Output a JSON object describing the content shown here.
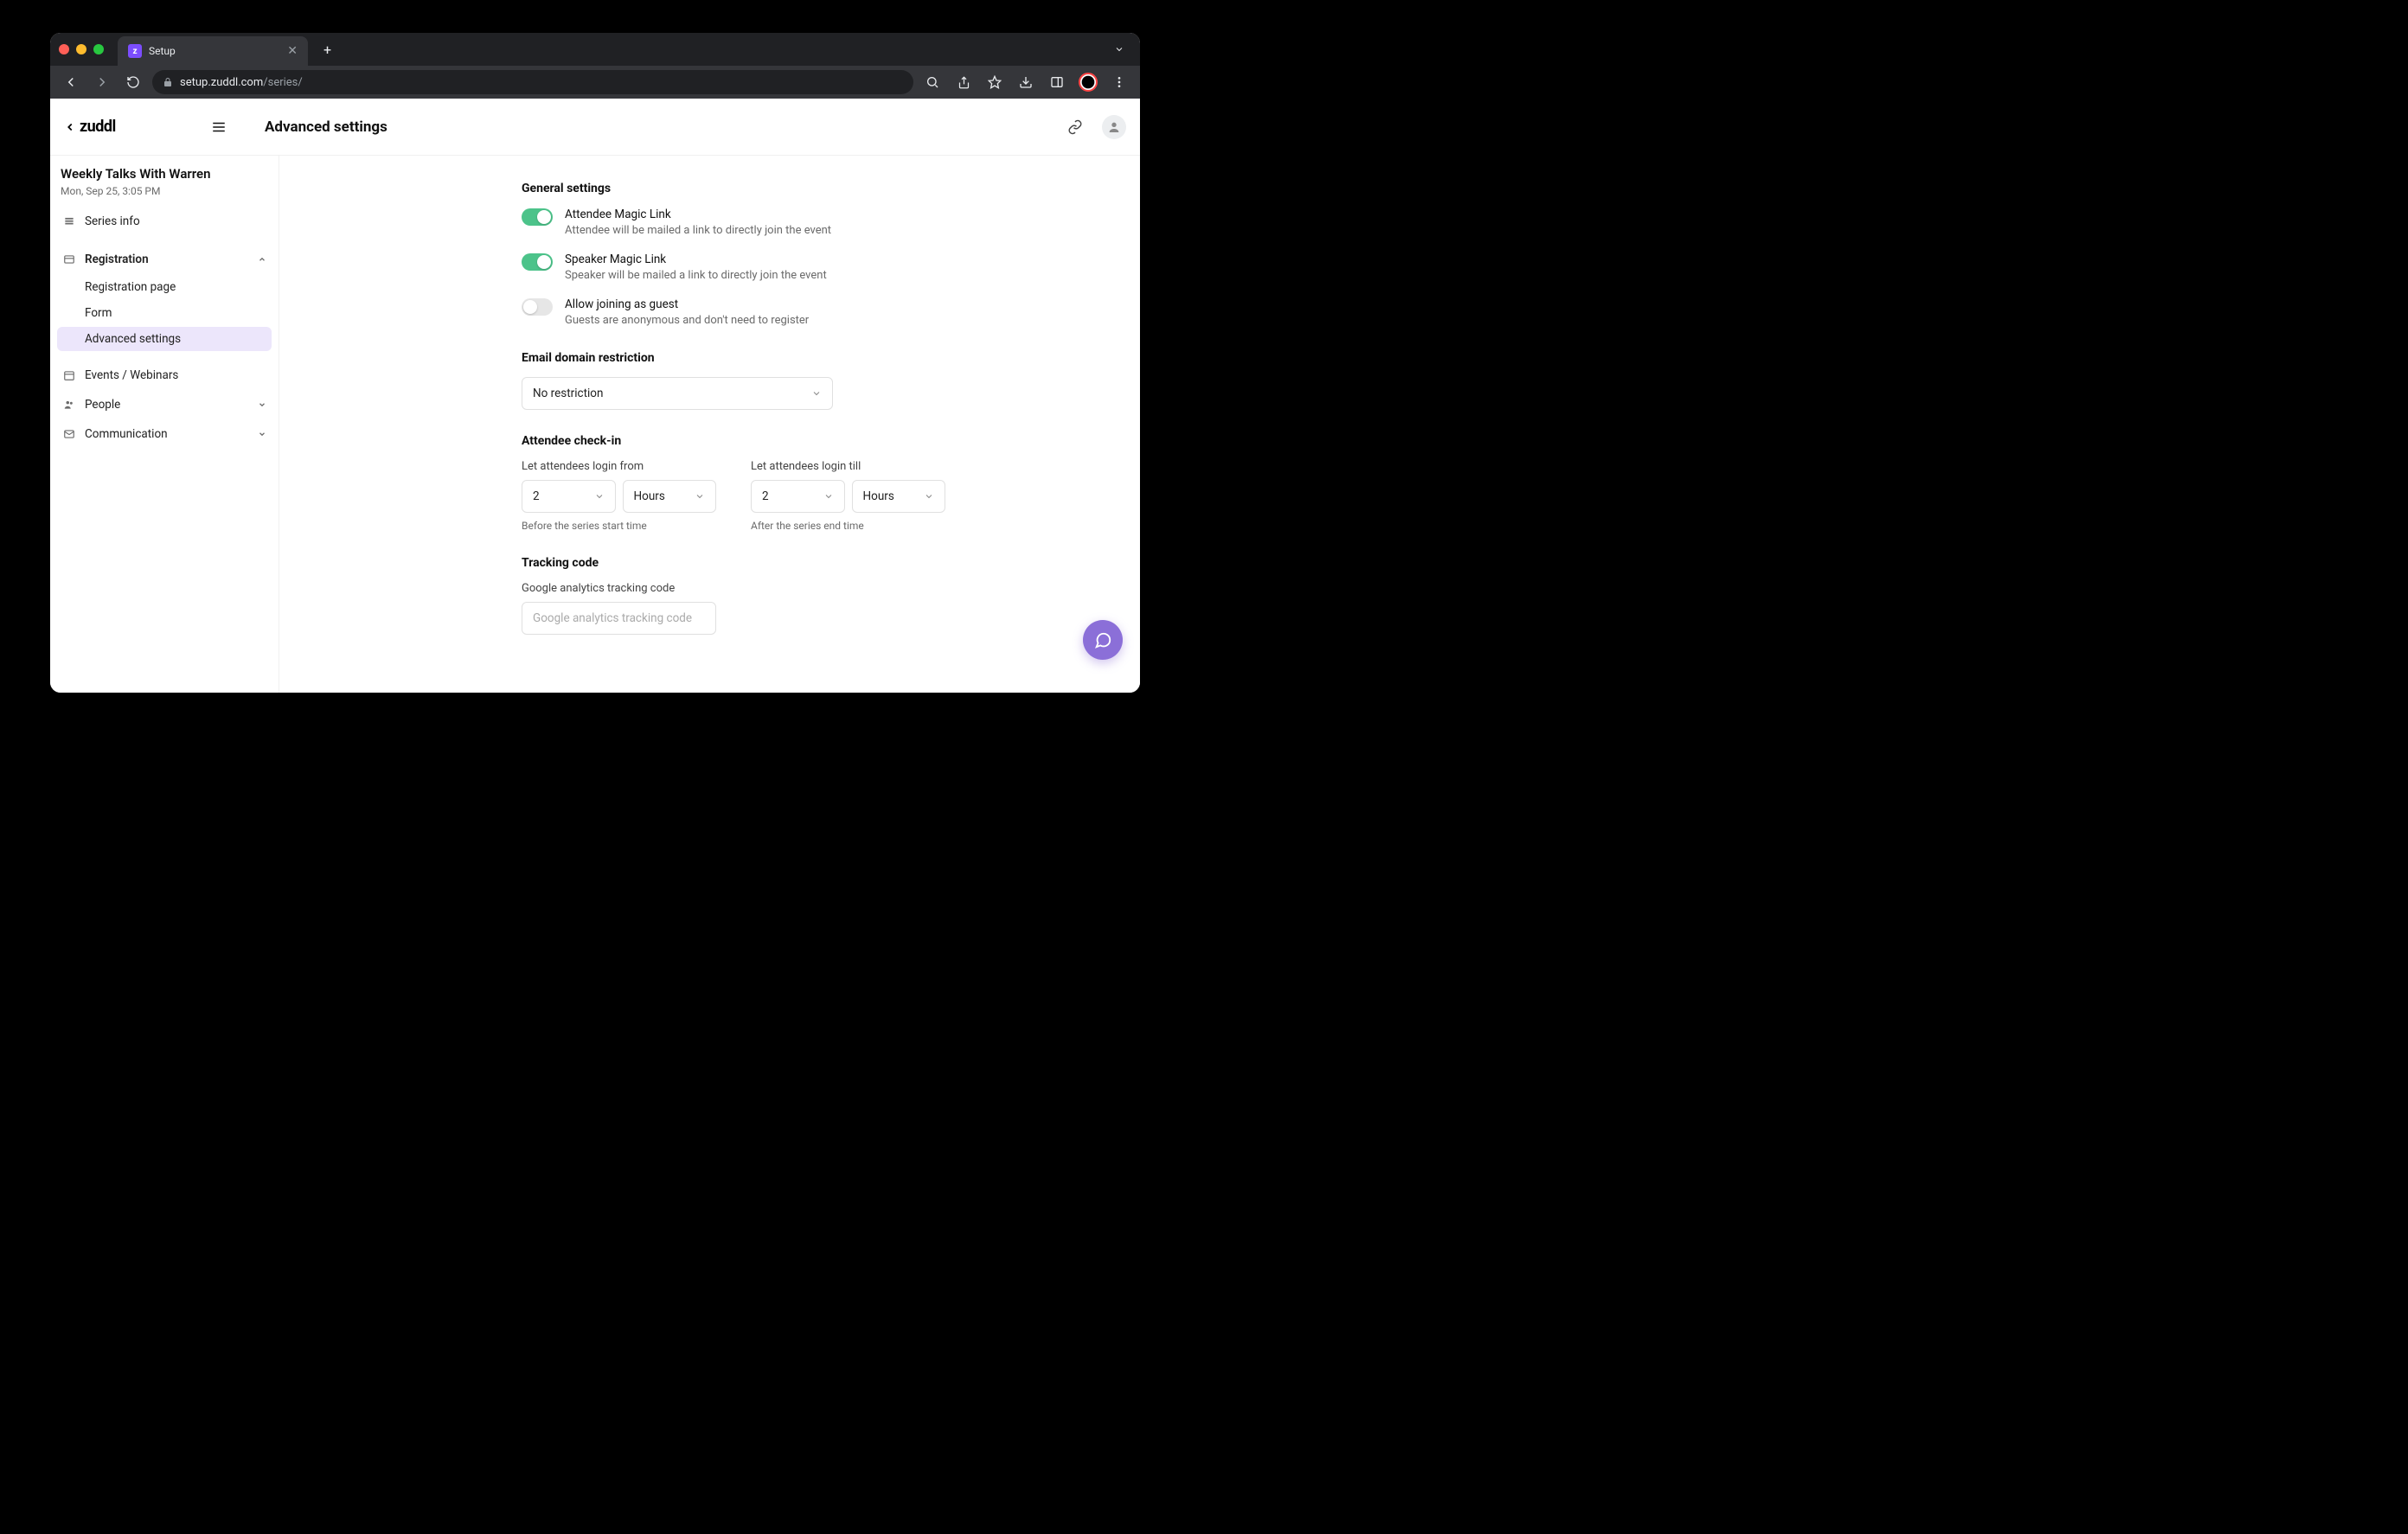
{
  "browser": {
    "tab_title": "Setup",
    "url_domain": "setup.zuddl.com",
    "url_path": "/series/"
  },
  "header": {
    "logo": "zuddl",
    "page_title": "Advanced settings"
  },
  "sidebar": {
    "event_title": "Weekly Talks With Warren",
    "event_date": "Mon, Sep 25, 3:05 PM",
    "items": [
      {
        "label": "Series info"
      },
      {
        "label": "Registration"
      },
      {
        "label": "Events / Webinars"
      },
      {
        "label": "People"
      },
      {
        "label": "Communication"
      }
    ],
    "sub_items": [
      {
        "label": "Registration page"
      },
      {
        "label": "Form"
      },
      {
        "label": "Advanced settings"
      }
    ]
  },
  "general": {
    "heading": "General settings",
    "items": [
      {
        "label": "Attendee Magic Link",
        "desc": "Attendee will be mailed a link to directly join the event",
        "on": true
      },
      {
        "label": "Speaker Magic Link",
        "desc": "Speaker will be mailed a link to directly join the event",
        "on": true
      },
      {
        "label": "Allow joining as guest",
        "desc": "Guests are anonymous and don't need to register",
        "on": false
      }
    ]
  },
  "domain_restriction": {
    "heading": "Email domain restriction",
    "value": "No restriction"
  },
  "checkin": {
    "heading": "Attendee check-in",
    "from_label": "Let attendees login from",
    "from_value": "2",
    "from_unit": "Hours",
    "from_hint": "Before the series start time",
    "till_label": "Let attendees login till",
    "till_value": "2",
    "till_unit": "Hours",
    "till_hint": "After the series end time"
  },
  "tracking": {
    "heading": "Tracking code",
    "label": "Google analytics tracking code",
    "placeholder": "Google analytics tracking code"
  }
}
